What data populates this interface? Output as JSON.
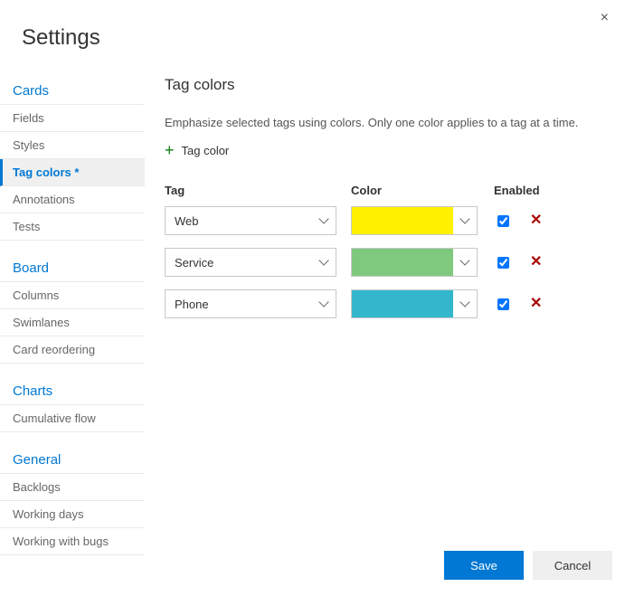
{
  "header": {
    "title": "Settings"
  },
  "close_label": "×",
  "sidebar": {
    "sections": [
      {
        "title": "Cards",
        "items": [
          {
            "label": "Fields",
            "active": false
          },
          {
            "label": "Styles",
            "active": false
          },
          {
            "label": "Tag colors *",
            "active": true
          },
          {
            "label": "Annotations",
            "active": false
          },
          {
            "label": "Tests",
            "active": false
          }
        ]
      },
      {
        "title": "Board",
        "items": [
          {
            "label": "Columns",
            "active": false
          },
          {
            "label": "Swimlanes",
            "active": false
          },
          {
            "label": "Card reordering",
            "active": false
          }
        ]
      },
      {
        "title": "Charts",
        "items": [
          {
            "label": "Cumulative flow",
            "active": false
          }
        ]
      },
      {
        "title": "General",
        "items": [
          {
            "label": "Backlogs",
            "active": false
          },
          {
            "label": "Working days",
            "active": false
          },
          {
            "label": "Working with bugs",
            "active": false
          }
        ]
      }
    ]
  },
  "main": {
    "title": "Tag colors",
    "description": "Emphasize selected tags using colors. Only one color applies to a tag at a time.",
    "add_button": {
      "icon": "+",
      "label": "Tag color"
    },
    "columns": {
      "tag": "Tag",
      "color": "Color",
      "enabled": "Enabled"
    },
    "rows": [
      {
        "tag": "Web",
        "color": "#fff100",
        "enabled": true
      },
      {
        "tag": "Service",
        "color": "#7fc97f",
        "enabled": true
      },
      {
        "tag": "Phone",
        "color": "#33b7cc",
        "enabled": true
      }
    ]
  },
  "footer": {
    "save": "Save",
    "cancel": "Cancel"
  }
}
